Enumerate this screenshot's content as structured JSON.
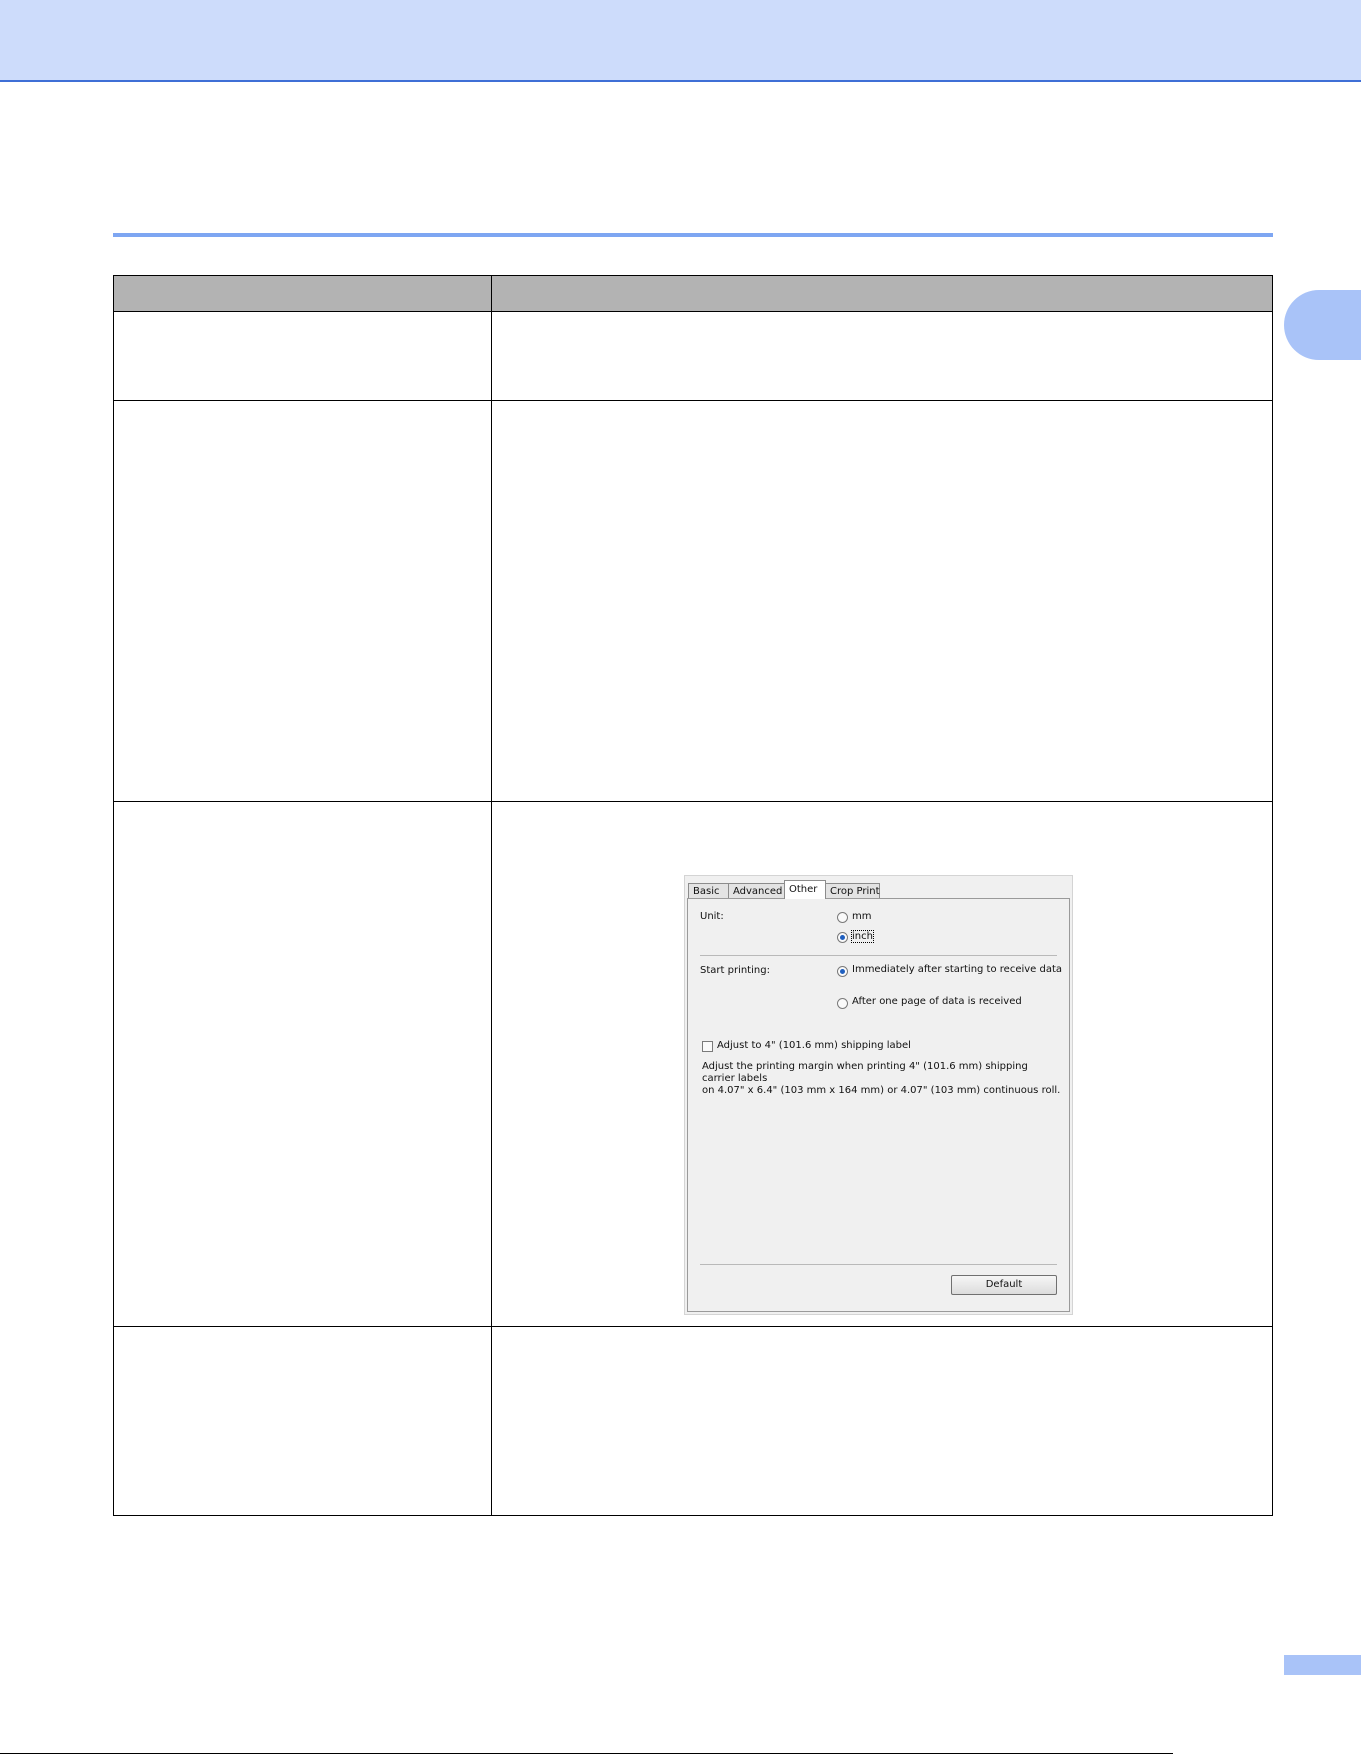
{
  "dialog": {
    "tabs": [
      {
        "label": "Basic"
      },
      {
        "label": "Advanced"
      },
      {
        "label": "Other"
      },
      {
        "label": "Crop Print"
      }
    ],
    "active_tab": "Other",
    "unit": {
      "label": "Unit:",
      "options": [
        "mm",
        "inch"
      ],
      "selected": "inch"
    },
    "start_printing": {
      "label": "Start printing:",
      "options": [
        "Immediately after starting to receive data",
        "After one page of data is received"
      ],
      "selected": "Immediately after starting to receive data"
    },
    "shipping_label": {
      "checkbox_label": "Adjust to 4\" (101.6 mm) shipping label",
      "checked": false,
      "description_line_1": "Adjust the printing margin when printing 4\" (101.6 mm) shipping carrier labels",
      "description_line_2": "on 4.07\" x 6.4\" (103 mm x 164 mm) or 4.07\" (103 mm) continuous roll."
    },
    "default_button": "Default"
  }
}
